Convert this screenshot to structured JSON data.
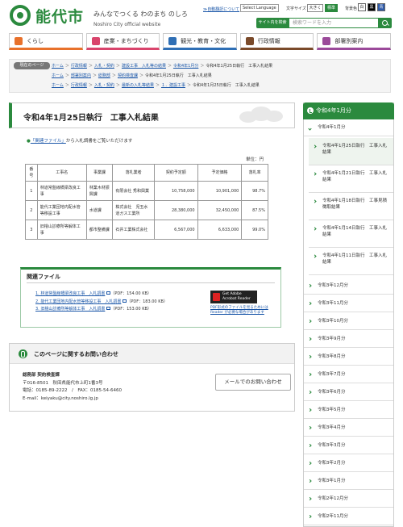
{
  "header": {
    "site_name": "能代市",
    "tagline": "みんなでつくる わのまち のしろ",
    "site_name_en": "Noshiro City official website",
    "auto_translate_link": "≫自動翻訳について",
    "language_select": "Select Language",
    "font_size_label": "文字サイズ",
    "font_size_large": "大きく",
    "font_size_standard": "標準",
    "bg_color_label": "背景色",
    "bg_color_white": "白",
    "bg_color_black": "黒",
    "bg_color_blue": "青",
    "search_label": "サイト内を検索",
    "search_placeholder": "検索ワードを入力"
  },
  "nav": {
    "items": [
      {
        "label": "くらし",
        "color": "#e8712b"
      },
      {
        "label": "産業・まちづくり",
        "color": "#d9446c"
      },
      {
        "label": "観光・教育・文化",
        "color": "#2f6fb5"
      },
      {
        "label": "行政情報",
        "color": "#7a4a2a"
      },
      {
        "label": "部署別案内",
        "color": "#9b4a9a"
      }
    ]
  },
  "breadcrumbs": {
    "tag": "現在のページ",
    "line1": [
      "ホーム",
      "行政情報",
      "入札・契約",
      "建設工事　入札等の結果",
      "令和4年1月分",
      "令和4年1月25日執行　工事入札結果"
    ],
    "line2": [
      "ホーム",
      "部署別案内",
      "総務部",
      "契約検査課",
      "令和4年1月25日執行　工事入札結果"
    ],
    "line3": [
      "ホーム",
      "行政情報",
      "入札・契約",
      "最新の入札等結果",
      "１．建設工事",
      "令和4年1月25日執行　工事入札結果"
    ]
  },
  "main": {
    "title": "令和4年1月25日執行　工事入札結果",
    "intro_link": "「関連ファイル」",
    "intro_rest": "から入札調書をご覧いただけます",
    "unit": "単位：円",
    "columns": [
      "番号",
      "工事名",
      "事業課",
      "落札業者",
      "契約予定額",
      "予定価格",
      "落札率"
    ],
    "rows": [
      {
        "no": "1",
        "name": "林道常盤線橋梁改良工事",
        "dept": "林業木材振興課",
        "winner": "有限会社 秀和興業",
        "contract": "10,758,000",
        "planned": "10,901,000",
        "rate": "98.7%"
      },
      {
        "no": "2",
        "name": "能代工業団地内配水管等移設工事",
        "dept": "水道課",
        "winner": "株式会社　児玉水道ガス工業所",
        "contract": "28,380,000",
        "planned": "32,450,000",
        "rate": "87.5%"
      },
      {
        "no": "3",
        "name": "旧檜山診療所等解体工事",
        "dept": "都市整備課",
        "winner": "石井工業株式会社",
        "contract": "6,567,000",
        "planned": "6,633,000",
        "rate": "99.0%"
      }
    ]
  },
  "related": {
    "title": "関連ファイル",
    "files": [
      {
        "label": "1. 林道常盤線橋梁改良工事　入札調書",
        "size": "（PDF：154.00 KB）"
      },
      {
        "label": "2. 能代工業団地内配水管等移設工事　入札調書",
        "size": "（PDF：183.00 KB）"
      },
      {
        "label": "3. 旧檜山診療所等解体工事　入札調書",
        "size": "（PDF：153.00 KB）"
      }
    ],
    "adobe_line1": "Get Adobe",
    "adobe_line2": "Acrobat Reader",
    "adobe_note": "PDF形式のファイルを見るためには Reader が必要な場合があります"
  },
  "contact": {
    "title": "このページに関するお問い合わせ",
    "dept": "総務部 契約検査課",
    "address": "〒016-8501　秋田県能代市上町1番3号",
    "phone": "電話：0185-89-2222　/　FAX：0185-54-6460",
    "email": "E-mail：keiyaku@city.noshiro.lg.jp",
    "mail_button": "メールでのお問い合わせ"
  },
  "sidebar": {
    "heading": "令和4年1月分",
    "current": "令和4年1月分",
    "sub_items": [
      "令和4年1月25日執行　工事入札結果",
      "令和4年1月21日執行　工事入札結果",
      "令和4年1月18日執行　工事見積徴取結果",
      "令和4年1月14日執行　工事入札結果",
      "令和4年1月11日執行　工事入札結果"
    ],
    "months": [
      "令和3年12月分",
      "令和3年11月分",
      "令和3年10月分",
      "令和3年9月分",
      "令和3年8月分",
      "令和3年7月分",
      "令和3年6月分",
      "令和3年5月分",
      "令和3年4月分",
      "令和3年3月分",
      "令和3年2月分",
      "令和3年1月分",
      "令和2年12月分",
      "令和2年11月分"
    ]
  }
}
